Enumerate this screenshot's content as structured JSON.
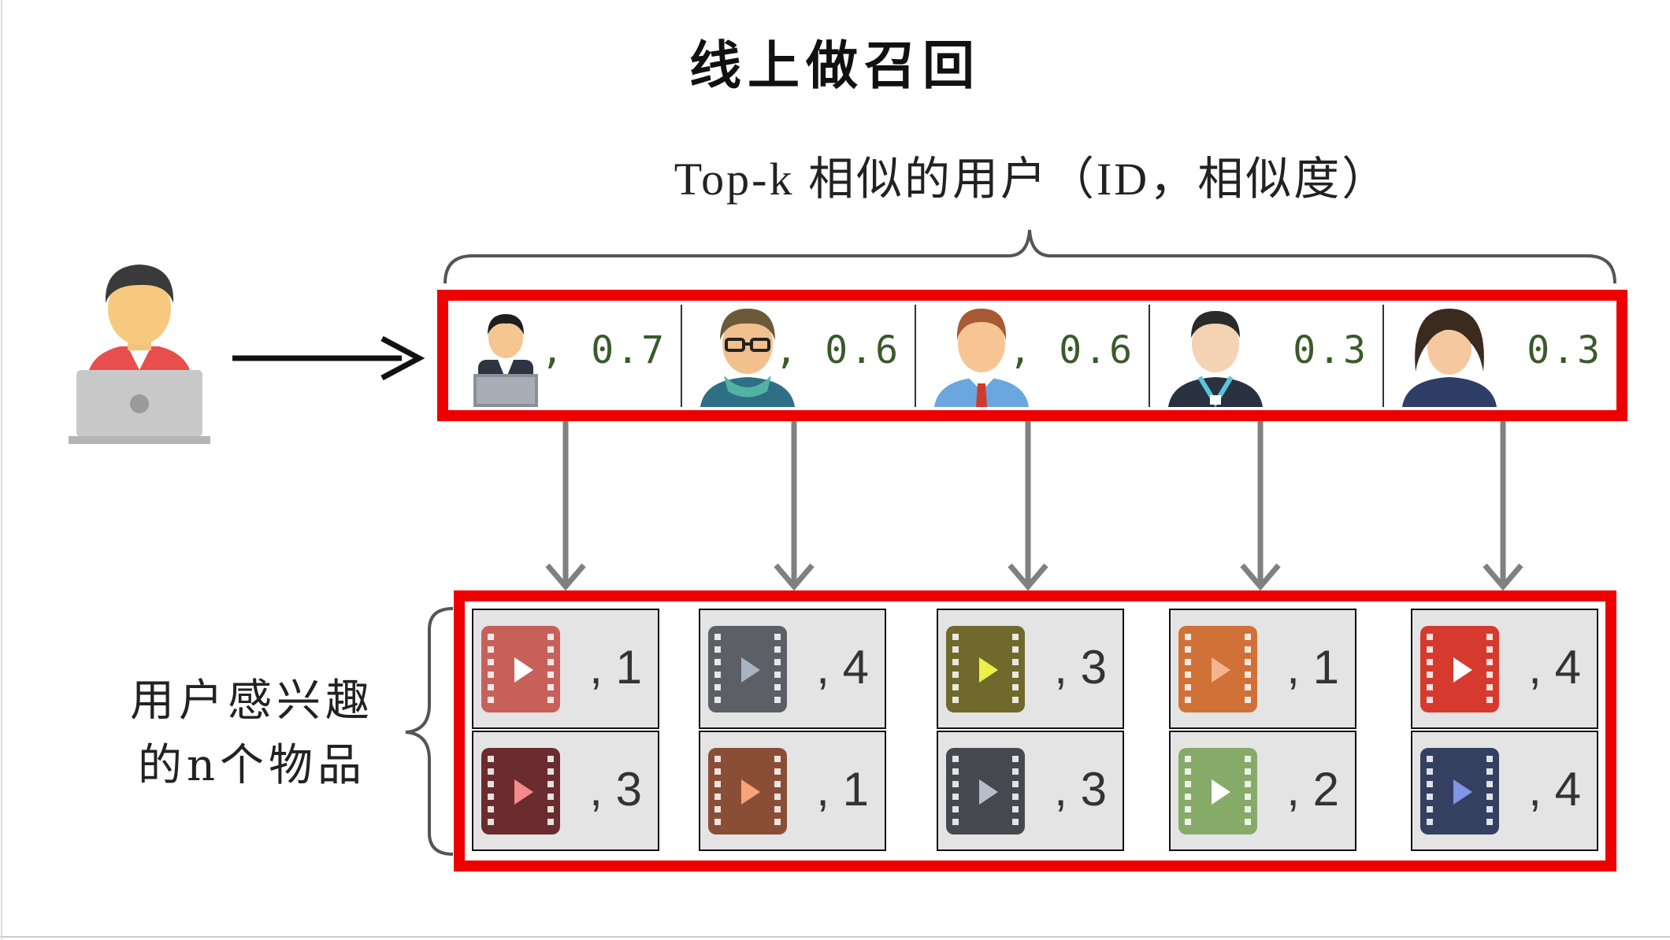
{
  "title": "线上做召回",
  "subtitle": "Top-k 相似的用户（ID，相似度）",
  "side_label_line1": "用户感兴趣",
  "side_label_line2": "的n个物品",
  "colors": {
    "highlight_box": "#ee0000",
    "arrow_gray": "#808080",
    "score_text": "#3a5a2a"
  },
  "similar_users": [
    {
      "avatar": "businessman-laptop-avatar",
      "score": ", 0.7"
    },
    {
      "avatar": "man-glasses-scarf-avatar",
      "score": ", 0.6"
    },
    {
      "avatar": "man-red-tie-avatar",
      "score": ", 0.6"
    },
    {
      "avatar": "man-lanyard-avatar",
      "score": "0.3"
    },
    {
      "avatar": "woman-avatar",
      "score": "0.3"
    }
  ],
  "items": [
    [
      {
        "icon": "video-icon",
        "color": "#c8605a",
        "count": ", 1"
      },
      {
        "icon": "video-icon",
        "color": "#6a2c2e",
        "count": ", 3"
      }
    ],
    [
      {
        "icon": "video-icon",
        "color": "#5c5f66",
        "count": ", 4"
      },
      {
        "icon": "video-icon",
        "color": "#8a4e36",
        "count": ", 1"
      }
    ],
    [
      {
        "icon": "video-icon",
        "color": "#6f6a2c",
        "count": ", 3"
      },
      {
        "icon": "video-icon",
        "color": "#45484f",
        "count": ", 3"
      }
    ],
    [
      {
        "icon": "video-icon",
        "color": "#d07238",
        "count": ", 1"
      },
      {
        "icon": "video-icon",
        "color": "#86aa68",
        "count": ", 2"
      }
    ],
    [
      {
        "icon": "video-icon",
        "color": "#d63a2e",
        "count": ", 4"
      },
      {
        "icon": "video-icon",
        "color": "#334060",
        "count": ", 4"
      }
    ]
  ]
}
